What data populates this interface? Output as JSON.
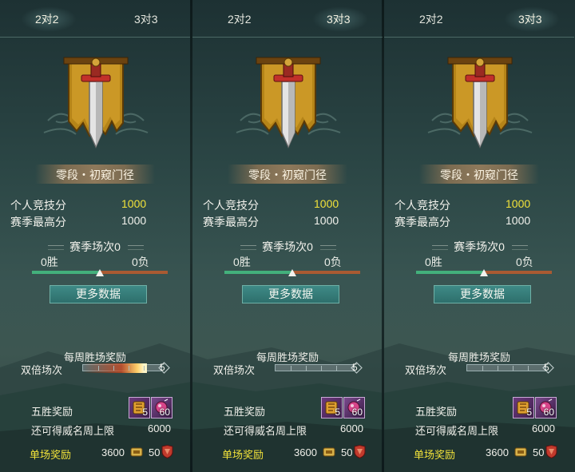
{
  "panels": [
    {
      "tabs": [
        "2对2",
        "3对3"
      ],
      "active_tab": 0,
      "rank_title": "零段・初窥门径",
      "stats": [
        {
          "label": "个人竞技分",
          "value": "1000"
        },
        {
          "label": "赛季最高分",
          "value": "1000"
        }
      ],
      "season_title": "赛季场次0",
      "wins": "0胜",
      "losses": "0负",
      "more_button": "更多数据",
      "weekly_title": "每周胜场奖励",
      "double_label": "双倍场次",
      "double_count": "5",
      "five_win_label": "五胜奖励",
      "five_win_items": [
        "5",
        "60"
      ],
      "remain_label": "还可得威名周上限",
      "remain_value": "6000",
      "single_label": "单场奖励",
      "single_value_1": "3600",
      "single_value_2": "50"
    },
    {
      "tabs": [
        "2对2",
        "3对3"
      ],
      "active_tab": 1,
      "rank_title": "零段・初窥门径",
      "stats": [
        {
          "label": "个人竞技分",
          "value": "1000"
        },
        {
          "label": "赛季最高分",
          "value": "1000"
        }
      ],
      "season_title": "赛季场次0",
      "wins": "0胜",
      "losses": "0负",
      "more_button": "更多数据",
      "weekly_title": "每周胜场奖励",
      "double_label": "双倍场次",
      "double_count": "5",
      "five_win_label": "五胜奖励",
      "five_win_items": [
        "5",
        "60"
      ],
      "remain_label": "还可得威名周上限",
      "remain_value": "6000",
      "single_label": "单场奖励",
      "single_value_1": "3600",
      "single_value_2": "50"
    },
    {
      "tabs": [
        "2对2",
        "3对3"
      ],
      "active_tab": 1,
      "rank_title": "零段・初窥门径",
      "stats": [
        {
          "label": "个人竞技分",
          "value": "1000"
        },
        {
          "label": "赛季最高分",
          "value": "1000"
        }
      ],
      "season_title": "赛季场次0",
      "wins": "0胜",
      "losses": "0负",
      "more_button": "更多数据",
      "weekly_title": "每周胜场奖励",
      "double_label": "双倍场次",
      "double_count": "5",
      "five_win_label": "五胜奖励",
      "five_win_items": [
        "5",
        "60"
      ],
      "remain_label": "还可得威名周上限",
      "remain_value": "6000",
      "single_label": "单场奖励",
      "single_value_1": "3600",
      "single_value_2": "50"
    }
  ],
  "win_ratio": 0.5,
  "double_progress": [
    1.0,
    0.0,
    0.0
  ],
  "colors": {
    "score_highlight": "#f1e23a",
    "bar_win": "#43b07c",
    "bar_loss": "#a95a32",
    "button": "#2e6f6c"
  },
  "icons": [
    "sword-banner-emblem-icon",
    "reward-item-icon",
    "potion-item-icon",
    "coin-icon",
    "shield-token-icon"
  ]
}
